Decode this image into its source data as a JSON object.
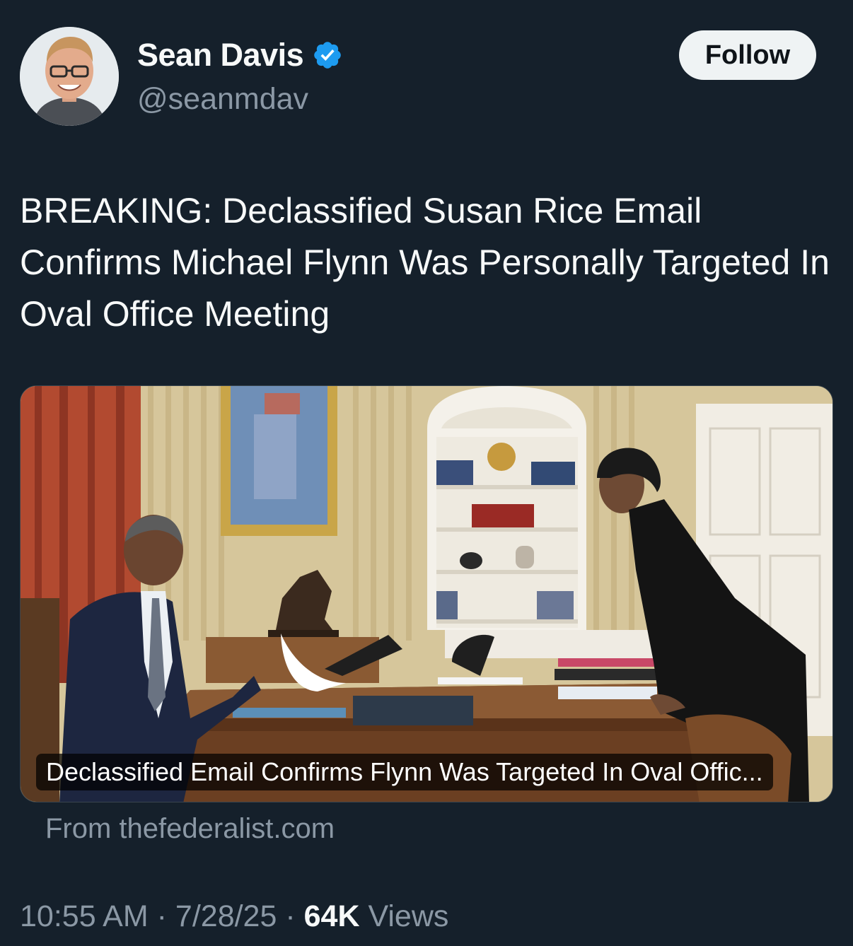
{
  "author": {
    "display_name": "Sean Davis",
    "handle": "@seanmdav",
    "verified": true,
    "verified_color": "#1d9bf0"
  },
  "follow_button": {
    "label": "Follow"
  },
  "tweet": {
    "text": "BREAKING: Declassified Susan Rice Email Confirms Michael Flynn Was Personally Targeted In Oval Office Meeting"
  },
  "link_card": {
    "title": "Declassified Email Confirms Flynn Was Targeted In Oval Offic...",
    "source": "From thefederalist.com"
  },
  "meta": {
    "time": "10:55 AM",
    "date": "7/28/25",
    "separator": "·",
    "views_count": "64K",
    "views_label": "Views"
  },
  "colors": {
    "background": "#15202b",
    "primary_text": "#f7f9f9",
    "secondary_text": "#8b98a5",
    "follow_button_bg": "#eff3f4"
  }
}
